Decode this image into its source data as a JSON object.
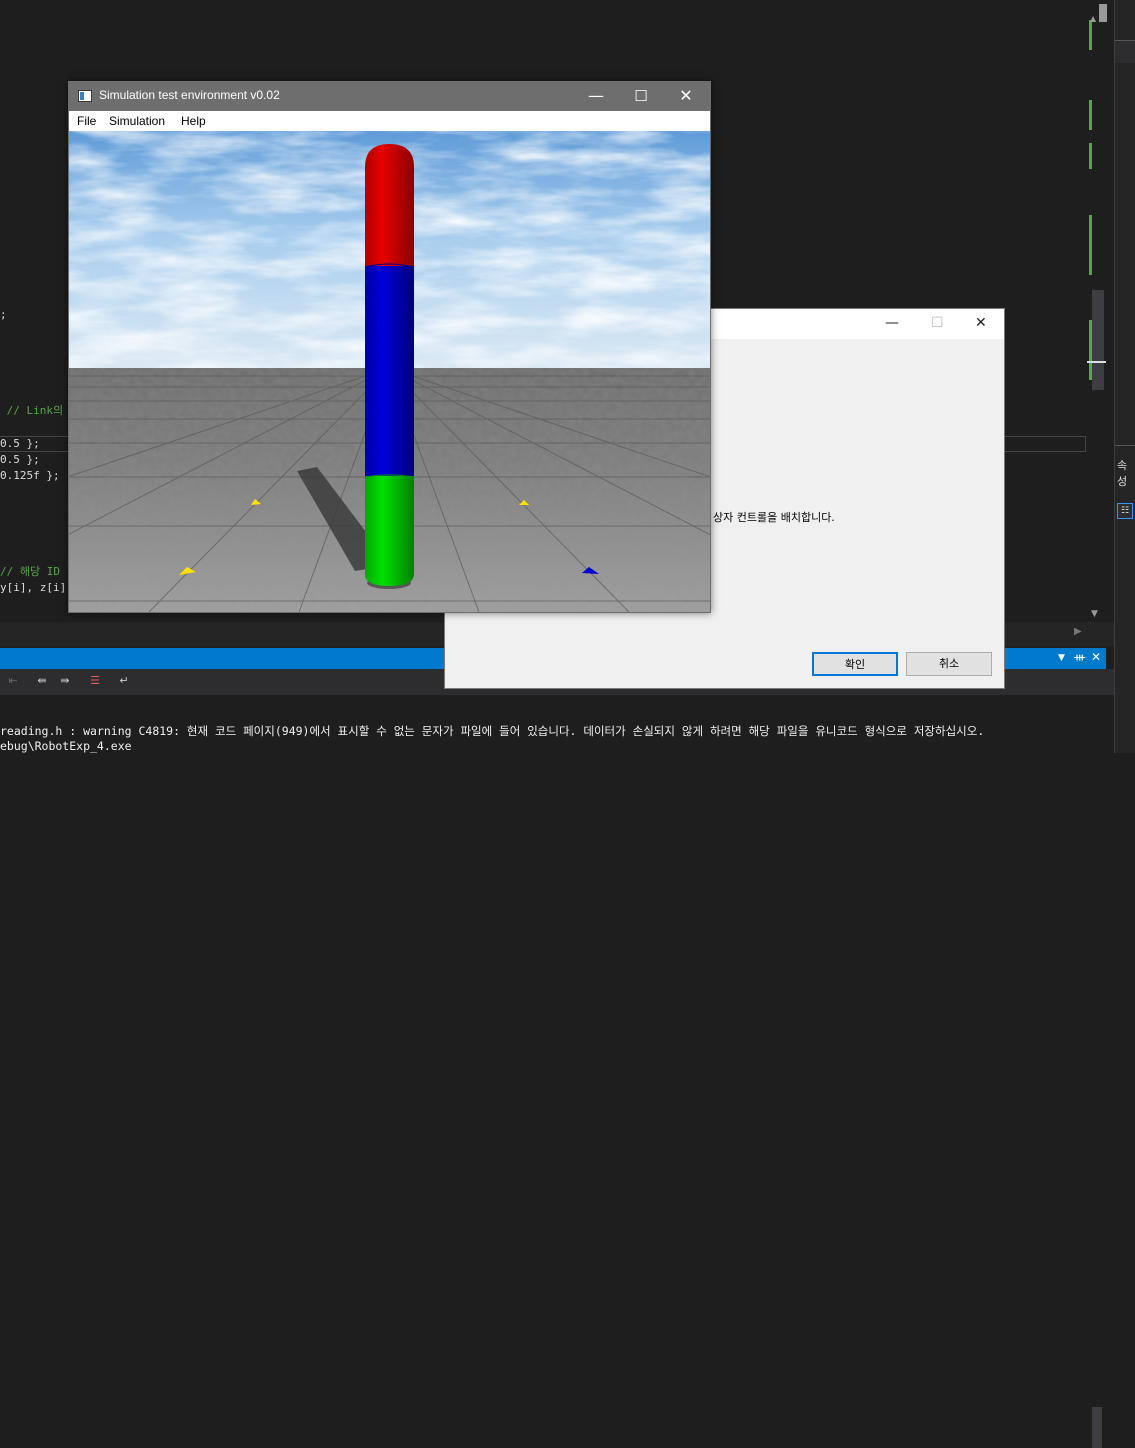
{
  "editor": {
    "code_lines": [
      {
        "text": ";",
        "kind": "code"
      },
      {
        "text": " // Link의",
        "kind": "comment"
      },
      {
        "text": "0.5 };",
        "kind": "code"
      },
      {
        "text": "0.5 };",
        "kind": "code"
      },
      {
        "text": "0.125f };",
        "kind": "code"
      },
      {
        "text": "// 해당 ID",
        "kind": "comment"
      },
      {
        "text": "y[i], z[i]",
        "kind": "code"
      }
    ]
  },
  "side_panel": {
    "label": "속성"
  },
  "dialog": {
    "message": "상자 컨트롤을 배치합니다.",
    "ok_label": "확인",
    "cancel_label": "취소"
  },
  "sim_window": {
    "title": "Simulation test environment v0.02",
    "menu": [
      "File",
      "Simulation",
      "Help"
    ],
    "scene": {
      "sky_color": "#9fc8ea",
      "floor_color": "#8c8c8c",
      "cylinder_segments": [
        {
          "color": "#d40000"
        },
        {
          "color": "#0000c8"
        },
        {
          "color": "#00c800"
        }
      ]
    }
  },
  "output": {
    "lines": [
      "reading.h : warning C4819: 현재 코드 페이지(949)에서 표시할 수 없는 문자가 파일에 들어 있습니다. 데이터가 손실되지 않게 하려면 해당 파일을 유니코드 형식으로 저장하십시오.",
      "ebug\\RobotExp_4.exe"
    ]
  }
}
